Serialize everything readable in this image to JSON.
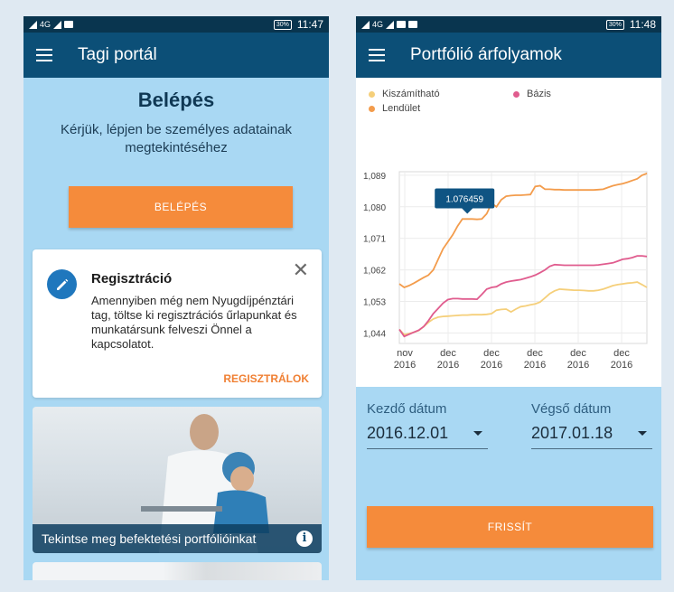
{
  "left": {
    "status": {
      "network": "4G",
      "battery": "30%",
      "time": "11:47"
    },
    "appbar": {
      "title": "Tagi portál"
    },
    "login": {
      "title": "Belépés",
      "subtitle": "Kérjük, lépjen be személyes adatainak megtekintéséhez",
      "button": "BELÉPÉS"
    },
    "register_card": {
      "title": "Regisztráció",
      "text": "Amennyiben még nem Nyugdíjpénztári tag, töltse ki regisztrációs űrlapunkat és munkatársunk felveszi Önnel a kapcsolatot.",
      "link": "REGISZTRÁLOK",
      "close": "✕"
    },
    "promo": {
      "caption": "Tekintse meg befektetési portfólióinkat",
      "info": "i"
    }
  },
  "right": {
    "status": {
      "network": "4G",
      "battery": "30%",
      "time": "11:48"
    },
    "appbar": {
      "title": "Portfólió árfolyamok"
    },
    "chart_data": {
      "type": "line",
      "title": "",
      "xlabel": "",
      "ylabel": "",
      "ylim": [
        1.041,
        1.09
      ],
      "yticks": [
        "1,089",
        "1,080",
        "1,071",
        "1,062",
        "1,053",
        "1,044"
      ],
      "ytick_values": [
        1.089,
        1.08,
        1.071,
        1.062,
        1.053,
        1.044
      ],
      "xticks": [
        {
          "line1": "nov",
          "line2": "2016"
        },
        {
          "line1": "dec",
          "line2": "2016"
        },
        {
          "line1": "dec",
          "line2": "2016"
        },
        {
          "line1": "dec",
          "line2": "2016"
        },
        {
          "line1": "dec",
          "line2": "2016"
        },
        {
          "line1": "dec",
          "line2": "2016"
        }
      ],
      "grid": true,
      "legend": "top-left",
      "tooltip": {
        "label": "1.076459",
        "value": 1.076459,
        "index": 14
      },
      "series": [
        {
          "name": "Kiszámítható",
          "color": "#f5cf7a",
          "values": [
            1.045,
            1.0435,
            1.0438,
            1.0442,
            1.0447,
            1.0458,
            1.047,
            1.048,
            1.0485,
            1.0487,
            1.0488,
            1.0489,
            1.049,
            1.0491,
            1.0491,
            1.0492,
            1.0492,
            1.0492,
            1.0493,
            1.0495,
            1.0505,
            1.0507,
            1.0508,
            1.05,
            1.0508,
            1.0515,
            1.0517,
            1.052,
            1.0523,
            1.0528,
            1.054,
            1.0552,
            1.056,
            1.0565,
            1.0564,
            1.0563,
            1.0562,
            1.0562,
            1.0561,
            1.056,
            1.056,
            1.0562,
            1.0565,
            1.057,
            1.0575,
            1.0578,
            1.058,
            1.0582,
            1.0583,
            1.0585,
            1.0578,
            1.057
          ]
        },
        {
          "name": "Bázis",
          "color": "#e05c8e",
          "values": [
            1.045,
            1.043,
            1.0436,
            1.0442,
            1.0448,
            1.0458,
            1.0475,
            1.0495,
            1.051,
            1.0525,
            1.0535,
            1.0538,
            1.0538,
            1.0537,
            1.0537,
            1.0537,
            1.0536,
            1.055,
            1.0565,
            1.057,
            1.0572,
            1.058,
            1.0585,
            1.0588,
            1.059,
            1.0592,
            1.0596,
            1.06,
            1.0605,
            1.0612,
            1.062,
            1.063,
            1.0635,
            1.0634,
            1.0633,
            1.0633,
            1.0633,
            1.0633,
            1.0633,
            1.0633,
            1.0633,
            1.0634,
            1.0636,
            1.0638,
            1.064,
            1.0645,
            1.065,
            1.0652,
            1.0655,
            1.066,
            1.066,
            1.0658
          ]
        },
        {
          "name": "Lendület",
          "color": "#f39c4c",
          "values": [
            1.058,
            1.057,
            1.0575,
            1.0582,
            1.059,
            1.0598,
            1.0605,
            1.062,
            1.065,
            1.068,
            1.07,
            1.072,
            1.0745,
            1.0765,
            1.0765,
            1.0765,
            1.0764,
            1.0765,
            1.078,
            1.081,
            1.08,
            1.082,
            1.083,
            1.0832,
            1.0833,
            1.0833,
            1.0834,
            1.0835,
            1.0858,
            1.086,
            1.085,
            1.085,
            1.0849,
            1.0849,
            1.0848,
            1.0848,
            1.0848,
            1.0848,
            1.0848,
            1.0848,
            1.0848,
            1.0849,
            1.085,
            1.0855,
            1.086,
            1.0863,
            1.0866,
            1.087,
            1.0875,
            1.088,
            1.089,
            1.0895
          ]
        }
      ]
    },
    "dates": {
      "start_label": "Kezdő dátum",
      "start_value": "2016.12.01",
      "end_label": "Végső dátum",
      "end_value": "2017.01.18"
    },
    "refresh": "FRISSÍT"
  }
}
